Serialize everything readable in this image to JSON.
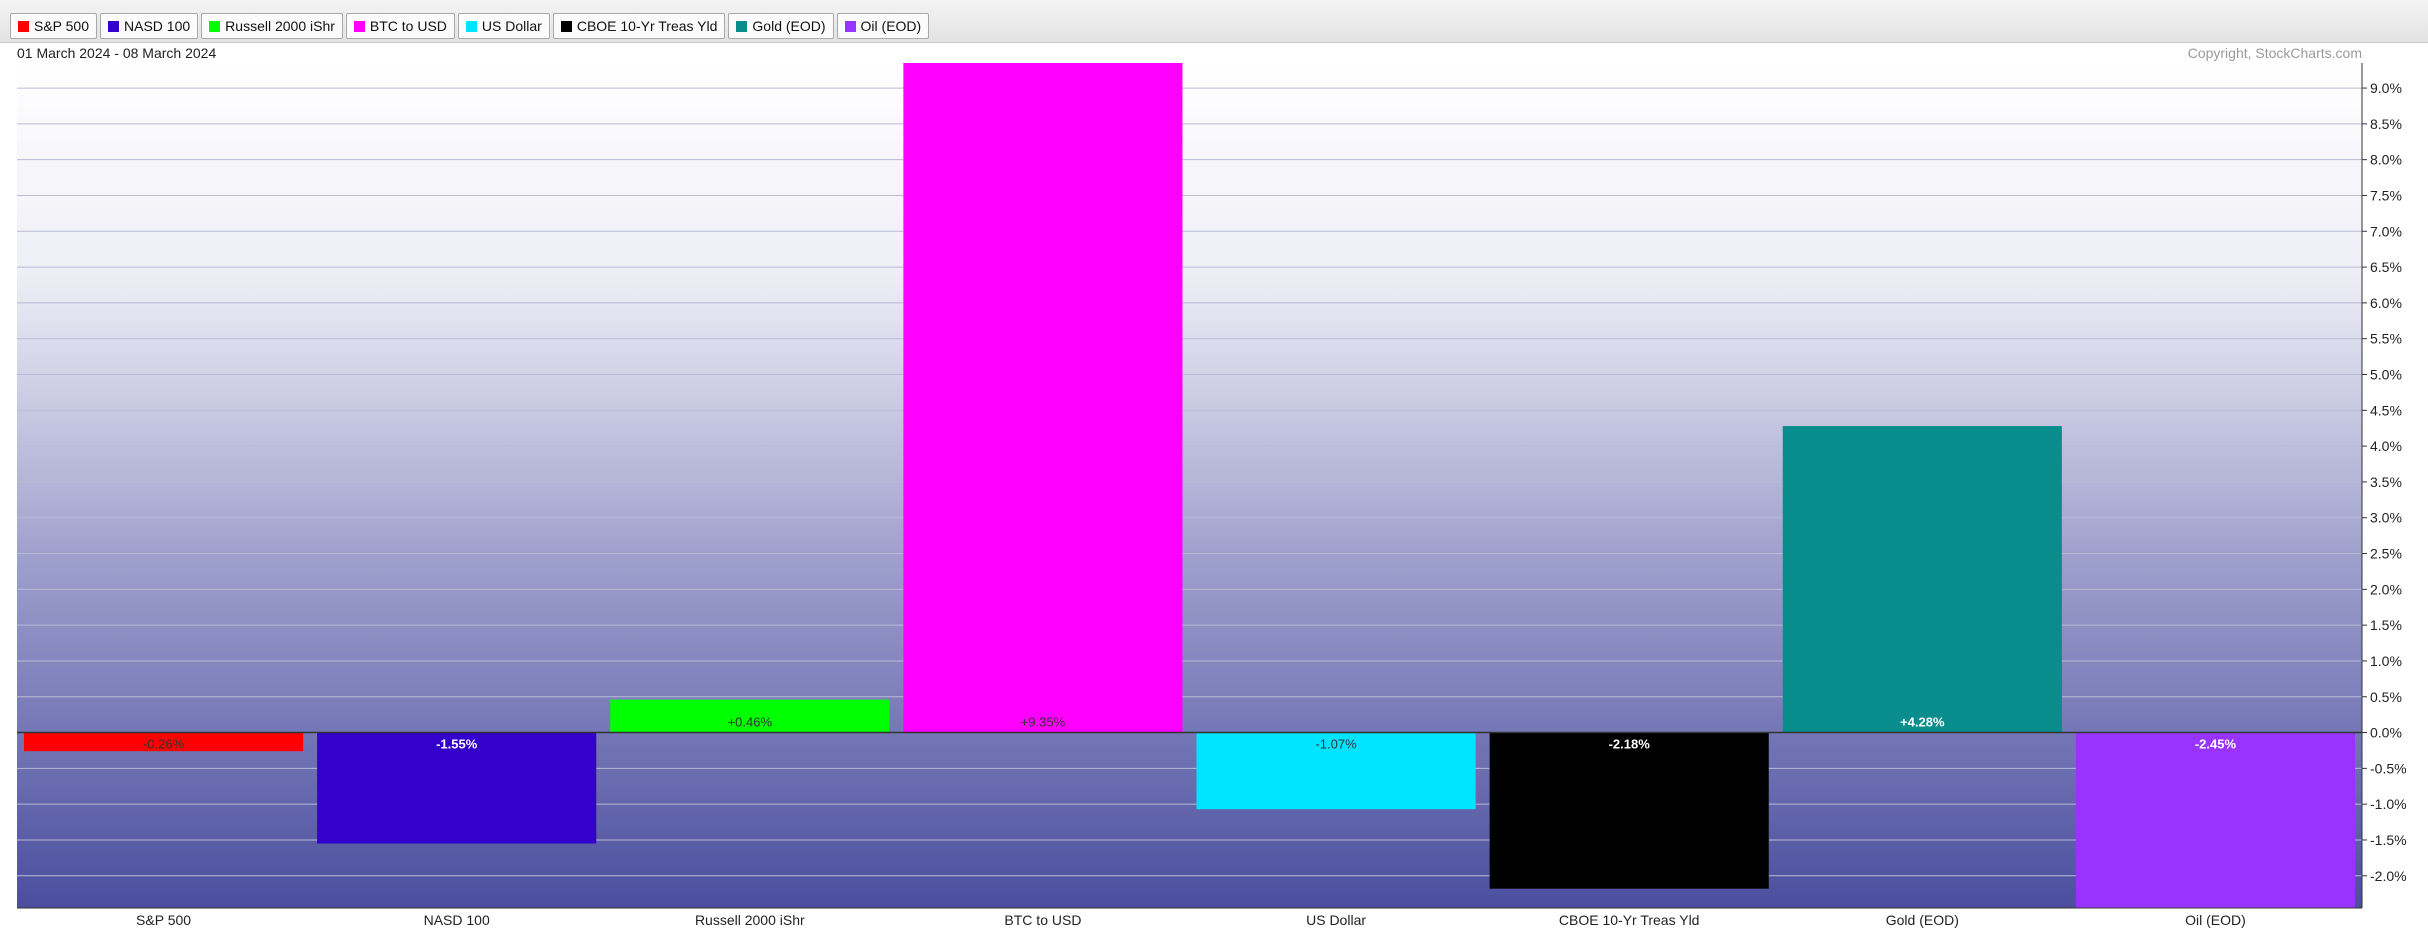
{
  "legend": [
    {
      "label": "S&P 500",
      "color": "#ff0000"
    },
    {
      "label": "NASD 100",
      "color": "#3300cc"
    },
    {
      "label": "Russell 2000 iShr",
      "color": "#00ff00"
    },
    {
      "label": "BTC to USD",
      "color": "#ff00ff"
    },
    {
      "label": "US Dollar",
      "color": "#00e5ff"
    },
    {
      "label": "CBOE 10-Yr Treas Yld",
      "color": "#000000"
    },
    {
      "label": "Gold (EOD)",
      "color": "#088c8c"
    },
    {
      "label": "Oil (EOD)",
      "color": "#9933ff"
    }
  ],
  "date_range": "01 March 2024 - 08 March 2024",
  "copyright": "Copyright, StockCharts.com",
  "chart_data": {
    "type": "bar",
    "categories": [
      "S&P 500",
      "NASD 100",
      "Russell 2000 iShr",
      "BTC to USD",
      "US Dollar",
      "CBOE 10-Yr Treas Yld",
      "Gold (EOD)",
      "Oil (EOD)"
    ],
    "values": [
      -0.26,
      -1.55,
      0.46,
      9.35,
      -1.07,
      -2.18,
      4.28,
      -2.45
    ],
    "value_labels": [
      "-0.26%",
      "-1.55%",
      "+0.46%",
      "+9.35%",
      "-1.07%",
      "-2.18%",
      "+4.28%",
      "-2.45%"
    ],
    "colors": [
      "#ff0000",
      "#3300cc",
      "#00ff00",
      "#ff00ff",
      "#00e5ff",
      "#000000",
      "#088c8c",
      "#9933ff"
    ],
    "label_colors": [
      "#333333",
      "#ffffff",
      "#333333",
      "#333333",
      "#333333",
      "#ffffff",
      "#ffffff",
      "#ffffff"
    ],
    "yticks": [
      9.0,
      8.5,
      8.0,
      7.5,
      7.0,
      6.5,
      6.0,
      5.5,
      5.0,
      4.5,
      4.0,
      3.5,
      3.0,
      2.5,
      2.0,
      1.5,
      1.0,
      0.5,
      0.0,
      -0.5,
      -1.0,
      -1.5,
      -2.0
    ],
    "ytick_labels": [
      "9.0%",
      "8.5%",
      "8.0%",
      "7.5%",
      "7.0%",
      "6.5%",
      "6.0%",
      "5.5%",
      "5.0%",
      "4.5%",
      "4.0%",
      "3.5%",
      "3.0%",
      "2.5%",
      "2.0%",
      "1.5%",
      "1.0%",
      "0.5%",
      "0.0%",
      "-0.5%",
      "-1.0%",
      "-1.5%",
      "-2.0%"
    ],
    "ylim": [
      -2.45,
      9.35
    ],
    "y_axis_position": "right",
    "grid": true,
    "legend_position": "top-left",
    "background_gradient": [
      "#ffffff",
      "#4a4e9e"
    ]
  }
}
